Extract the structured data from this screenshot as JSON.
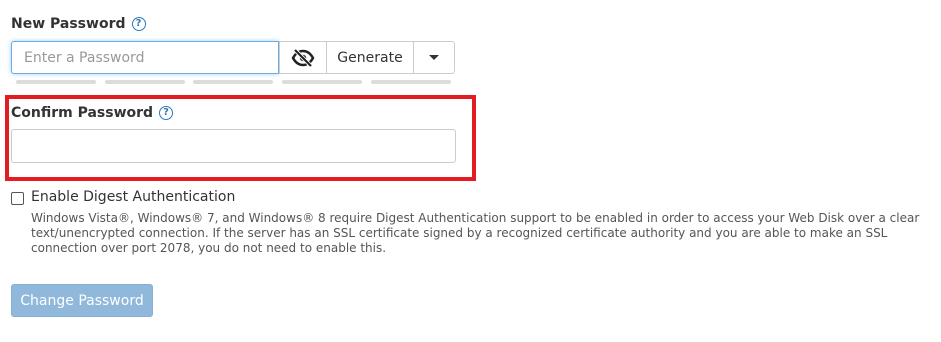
{
  "new_password": {
    "label": "New Password",
    "help_icon": "question-circle-icon",
    "placeholder": "Enter a Password",
    "value": "",
    "visibility_icon": "eye-slash-icon",
    "generate_label": "Generate",
    "dropdown_icon": "caret-down-icon",
    "strength_segments": 5
  },
  "confirm_password": {
    "label": "Confirm Password",
    "help_icon": "question-circle-icon",
    "value": "",
    "highlighted": true,
    "highlight_color": "#e31c24"
  },
  "digest": {
    "checkbox_label": "Enable Digest Authentication",
    "checked": false,
    "description": "Windows Vista®, Windows® 7, and Windows® 8 require Digest Authentication support to be enabled in order to access your Web Disk over a clear text/unencrypted connection. If the server has an SSL certificate signed by a recognized certificate authority and you are able to make an SSL connection over port 2078, you do not need to enable this."
  },
  "submit": {
    "label": "Change Password",
    "disabled": true,
    "color": "#8fb8db"
  },
  "colors": {
    "accent": "#2e79b9",
    "focus_border": "#66afe9",
    "input_border": "#cccccc"
  }
}
